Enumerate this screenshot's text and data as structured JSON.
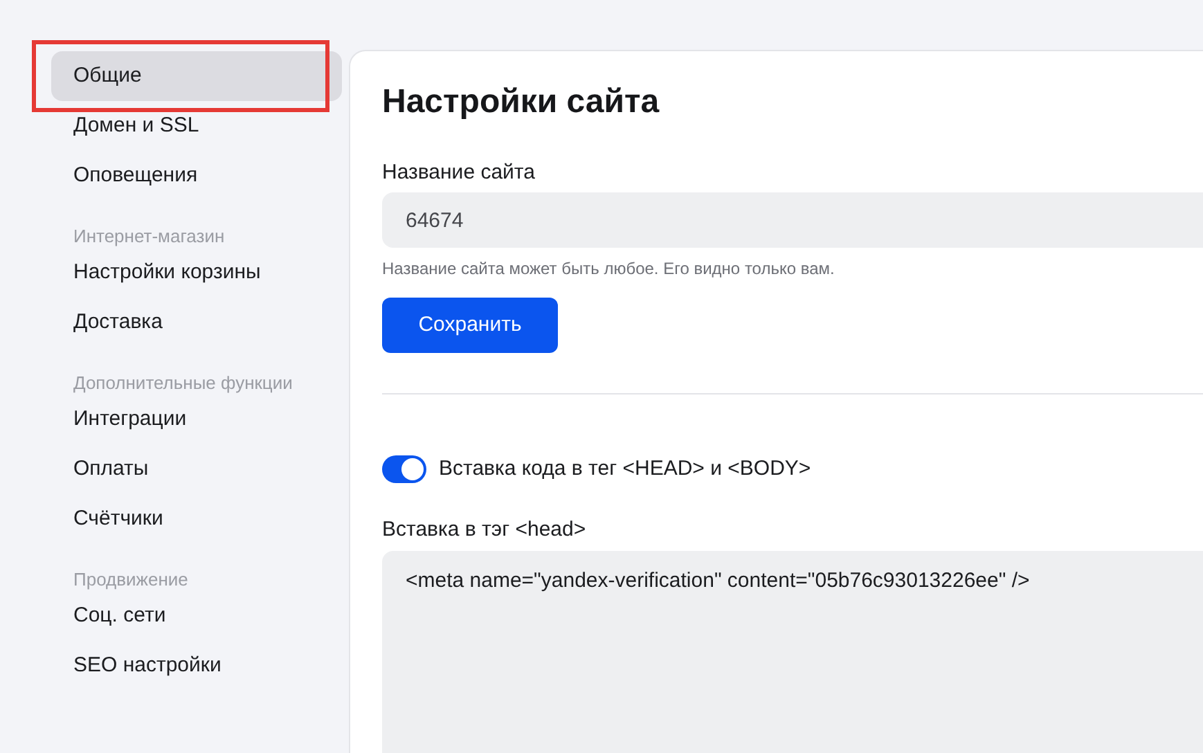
{
  "sidebar": {
    "sections": [
      {
        "items": [
          {
            "label": "Общие",
            "selected": true,
            "highlighted": true
          },
          {
            "label": "Домен и SSL",
            "selected": false,
            "highlighted": false
          },
          {
            "label": "Оповещения",
            "selected": false,
            "highlighted": false
          }
        ]
      },
      {
        "header": "Интернет-магазин",
        "items": [
          {
            "label": "Настройки корзины",
            "selected": false,
            "highlighted": false
          },
          {
            "label": "Доставка",
            "selected": false,
            "highlighted": false
          }
        ]
      },
      {
        "header": "Дополнительные функции",
        "items": [
          {
            "label": "Интеграции",
            "selected": false,
            "highlighted": false
          },
          {
            "label": "Оплаты",
            "selected": false,
            "highlighted": false
          },
          {
            "label": "Счётчики",
            "selected": false,
            "highlighted": false
          }
        ]
      },
      {
        "header": "Продвижение",
        "items": [
          {
            "label": "Соц. сети",
            "selected": false,
            "highlighted": false
          },
          {
            "label": "SEO настройки",
            "selected": false,
            "highlighted": false
          }
        ]
      }
    ]
  },
  "page": {
    "title": "Настройки сайта",
    "site_name": {
      "label": "Название сайта",
      "value": "64674",
      "hint": "Название сайта может быть любое. Его видно только вам."
    },
    "save_button": "Сохранить",
    "code_toggle": {
      "label": "Вставка кода в тег <HEAD> и <BODY>",
      "on": true
    },
    "head_code": {
      "label": "Вставка в тэг <head>",
      "value": "<meta name=\"yandex-verification\" content=\"05b76c93013226ee\" />"
    }
  }
}
